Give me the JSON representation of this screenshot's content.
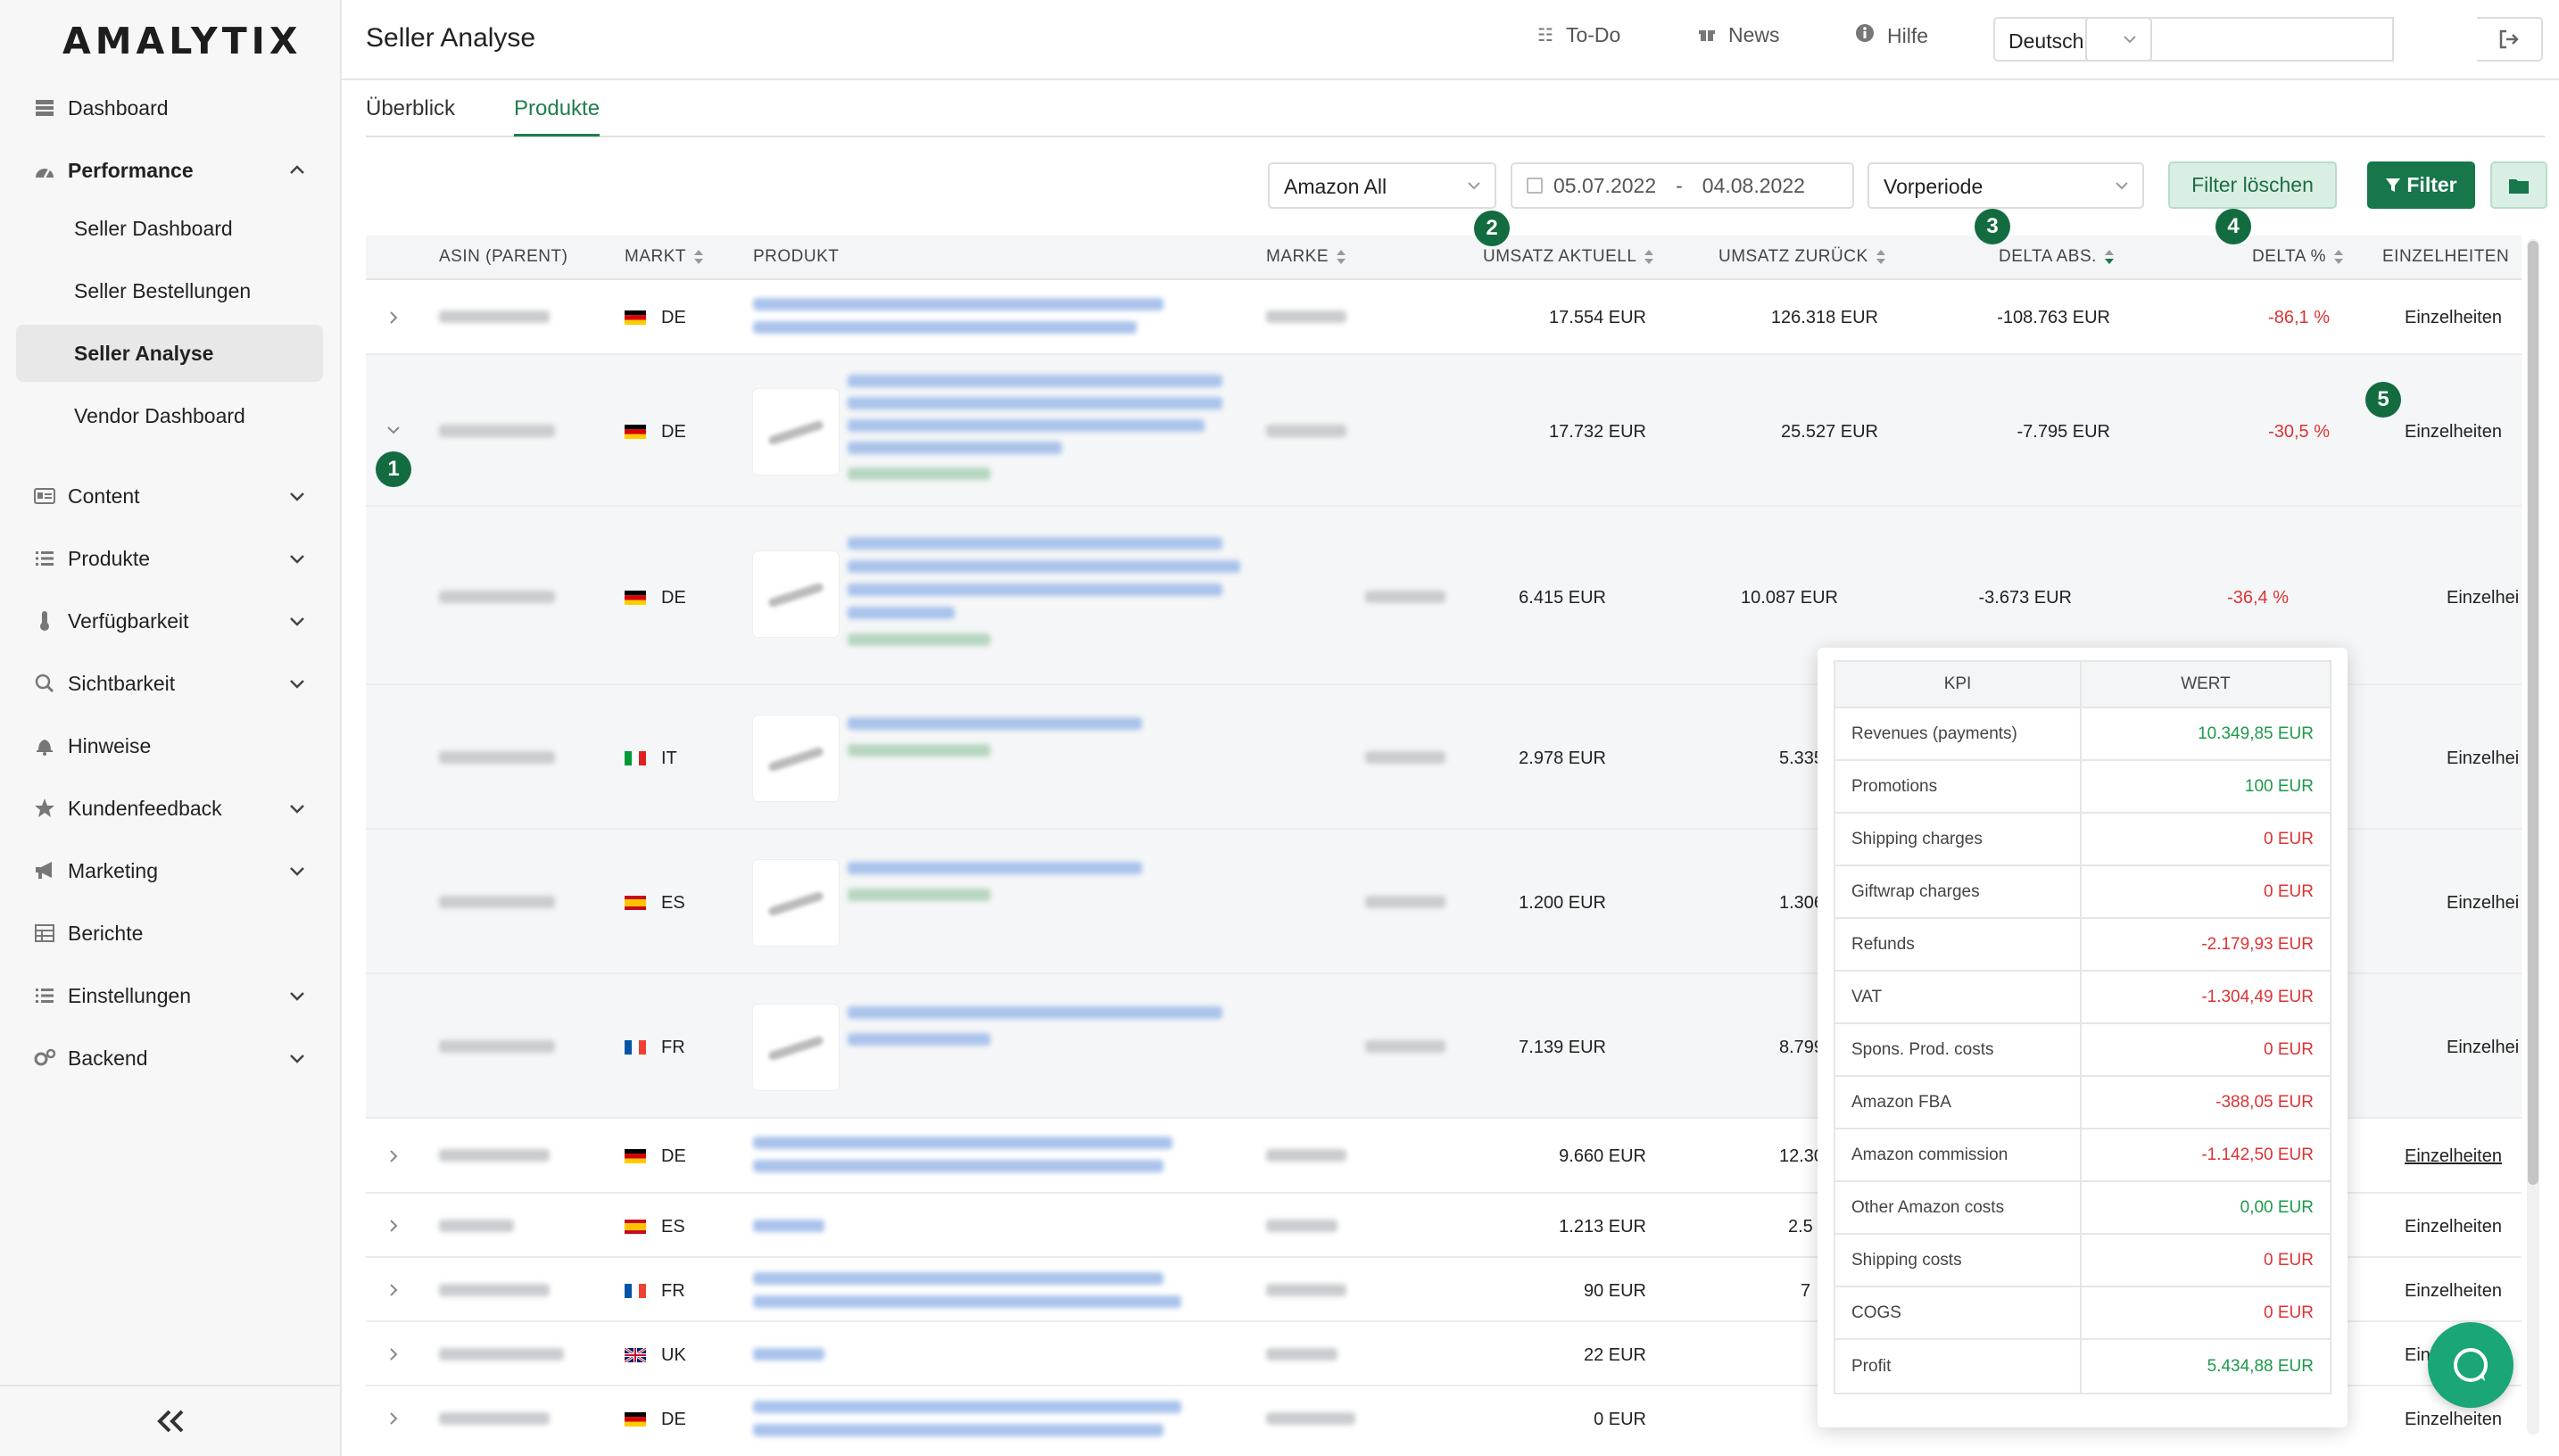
{
  "sidebar": {
    "logo": "AMALYTIX",
    "items": [
      {
        "label": "Dashboard"
      },
      {
        "label": "Performance"
      },
      {
        "label": "Content"
      },
      {
        "label": "Produkte"
      },
      {
        "label": "Verfügbarkeit"
      },
      {
        "label": "Sichtbarkeit"
      },
      {
        "label": "Hinweise"
      },
      {
        "label": "Kundenfeedback"
      },
      {
        "label": "Marketing"
      },
      {
        "label": "Berichte"
      },
      {
        "label": "Einstellungen"
      },
      {
        "label": "Backend"
      }
    ],
    "sub_items": [
      {
        "label": "Seller Dashboard"
      },
      {
        "label": "Seller Bestellungen"
      },
      {
        "label": "Seller Analyse"
      },
      {
        "label": "Vendor Dashboard"
      }
    ],
    "collapse_icon": "double-chevron-left-icon"
  },
  "header": {
    "title": "Seller Analyse",
    "todo": "To-Do",
    "news": "News",
    "help": "Hilfe",
    "language": "Deutsch",
    "search_value": ""
  },
  "tabs": [
    {
      "label": "Überblick"
    },
    {
      "label": "Produkte"
    }
  ],
  "filters": {
    "marketplace": "Amazon All",
    "date_from": "05.07.2022",
    "date_sep": "-",
    "date_to": "04.08.2022",
    "compare": "Vorperiode",
    "clear_label": "Filter löschen",
    "filter_label": "Filter"
  },
  "table": {
    "headers": [
      "ASIN (PARENT)",
      "MARKT",
      "PRODUKT",
      "MARKE",
      "UMSATZ AKTUELL",
      "UMSATZ ZURÜCK",
      "DELTA ABS.",
      "DELTA %",
      "EINZELHEITEN"
    ],
    "rows": [
      {
        "market": "DE",
        "current": "17.554 EUR",
        "previous": "126.318 EUR",
        "delta_abs": "-108.763 EUR",
        "delta_pct": "-86,1 %",
        "details": "Einzelheiten"
      },
      {
        "market": "DE",
        "current": "17.732 EUR",
        "previous": "25.527 EUR",
        "delta_abs": "-7.795 EUR",
        "delta_pct": "-30,5 %",
        "details": "Einzelheiten"
      },
      {
        "market": "DE",
        "current": "6.415 EUR",
        "previous": "10.087 EUR",
        "delta_abs": "-3.673 EUR",
        "delta_pct": "-36,4 %",
        "details": "Einzelhei"
      },
      {
        "market": "IT",
        "current": "2.978 EUR",
        "previous": "5.335",
        "delta_abs": "",
        "delta_pct": "",
        "details": "Einzelhei"
      },
      {
        "market": "ES",
        "current": "1.200 EUR",
        "previous": "1.306",
        "delta_abs": "",
        "delta_pct": "",
        "details": "Einzelhei"
      },
      {
        "market": "FR",
        "current": "7.139 EUR",
        "previous": "8.799",
        "delta_abs": "",
        "delta_pct": "",
        "details": "Einzelhei"
      },
      {
        "market": "DE",
        "current": "9.660 EUR",
        "previous": "12.30",
        "delta_abs": "",
        "delta_pct": "",
        "details": "Einzelheiten"
      },
      {
        "market": "ES",
        "current": "1.213 EUR",
        "previous": "2.5",
        "delta_abs": "",
        "delta_pct": "",
        "details": "Einzelheiten"
      },
      {
        "market": "FR",
        "current": "90 EUR",
        "previous": "7",
        "delta_abs": "",
        "delta_pct": "",
        "details": "Einzelheiten"
      },
      {
        "market": "UK",
        "current": "22 EUR",
        "previous": "",
        "delta_abs": "",
        "delta_pct": "",
        "details": "Ein"
      },
      {
        "market": "DE",
        "current": "0 EUR",
        "previous": "",
        "delta_abs": "",
        "delta_pct": "",
        "details": "Einzelheiten"
      }
    ]
  },
  "badges": [
    "1",
    "2",
    "3",
    "4",
    "5"
  ],
  "kpi": {
    "header_kpi": "KPI",
    "header_value": "WERT",
    "rows": [
      {
        "label": "Revenues (payments)",
        "value": "10.349,85 EUR",
        "sign": "pos"
      },
      {
        "label": "Promotions",
        "value": "100 EUR",
        "sign": "pos"
      },
      {
        "label": "Shipping charges",
        "value": "0 EUR",
        "sign": "neg"
      },
      {
        "label": "Giftwrap charges",
        "value": "0 EUR",
        "sign": "neg"
      },
      {
        "label": "Refunds",
        "value": "-2.179,93 EUR",
        "sign": "neg"
      },
      {
        "label": "VAT",
        "value": "-1.304,49 EUR",
        "sign": "neg"
      },
      {
        "label": "Spons. Prod. costs",
        "value": "0 EUR",
        "sign": "neg"
      },
      {
        "label": "Amazon FBA",
        "value": "-388,05 EUR",
        "sign": "neg"
      },
      {
        "label": "Amazon commission",
        "value": "-1.142,50 EUR",
        "sign": "neg"
      },
      {
        "label": "Other Amazon costs",
        "value": "0,00 EUR",
        "sign": "pos"
      },
      {
        "label": "Shipping costs",
        "value": "0 EUR",
        "sign": "neg"
      },
      {
        "label": "COGS",
        "value": "0 EUR",
        "sign": "neg"
      },
      {
        "label": "Profit",
        "value": "5.434,88 EUR",
        "sign": "pos"
      }
    ]
  },
  "colors": {
    "accent": "#1e7f4d",
    "primary_button": "#17764a",
    "negative": "#dd3333",
    "positive": "#1d9a4a",
    "badge": "#136b40",
    "chat": "#1aa676"
  }
}
